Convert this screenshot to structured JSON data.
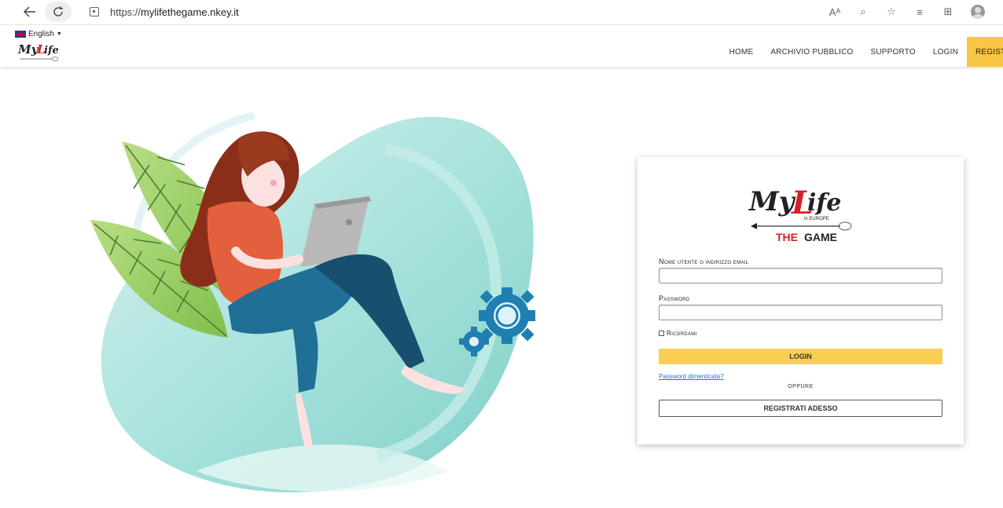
{
  "browser": {
    "url_scheme": "https://",
    "url_host": "mylifethegame.nkey.it",
    "tools": [
      "Aᴬ",
      "⌕",
      "☆",
      "≡",
      "⊞"
    ]
  },
  "header": {
    "language": "English",
    "nav": [
      "HOME",
      "ARCHIVIO PUBBLICO",
      "SUPPORTO",
      "LOGIN",
      "REGISTRATI"
    ]
  },
  "login": {
    "logo_tagline": "in EUROPE",
    "logo_game": "THE GAME",
    "username_label": "Nome utente o indirizzo email",
    "username_value": "",
    "password_label": "Password",
    "password_value": "",
    "remember_label": "Ricordami",
    "login_button": "LOGIN",
    "forgot_link": "Password dimenticata?",
    "or_text": "OPPURE",
    "register_button": "REGISTRATI ADESSO"
  },
  "colors": {
    "accent_yellow": "#f8cf52",
    "link_blue": "#2b6fd6",
    "logo_red": "#d81f26",
    "blob_teal": "#8fd8d2",
    "gear_blue": "#1f7fb0"
  }
}
